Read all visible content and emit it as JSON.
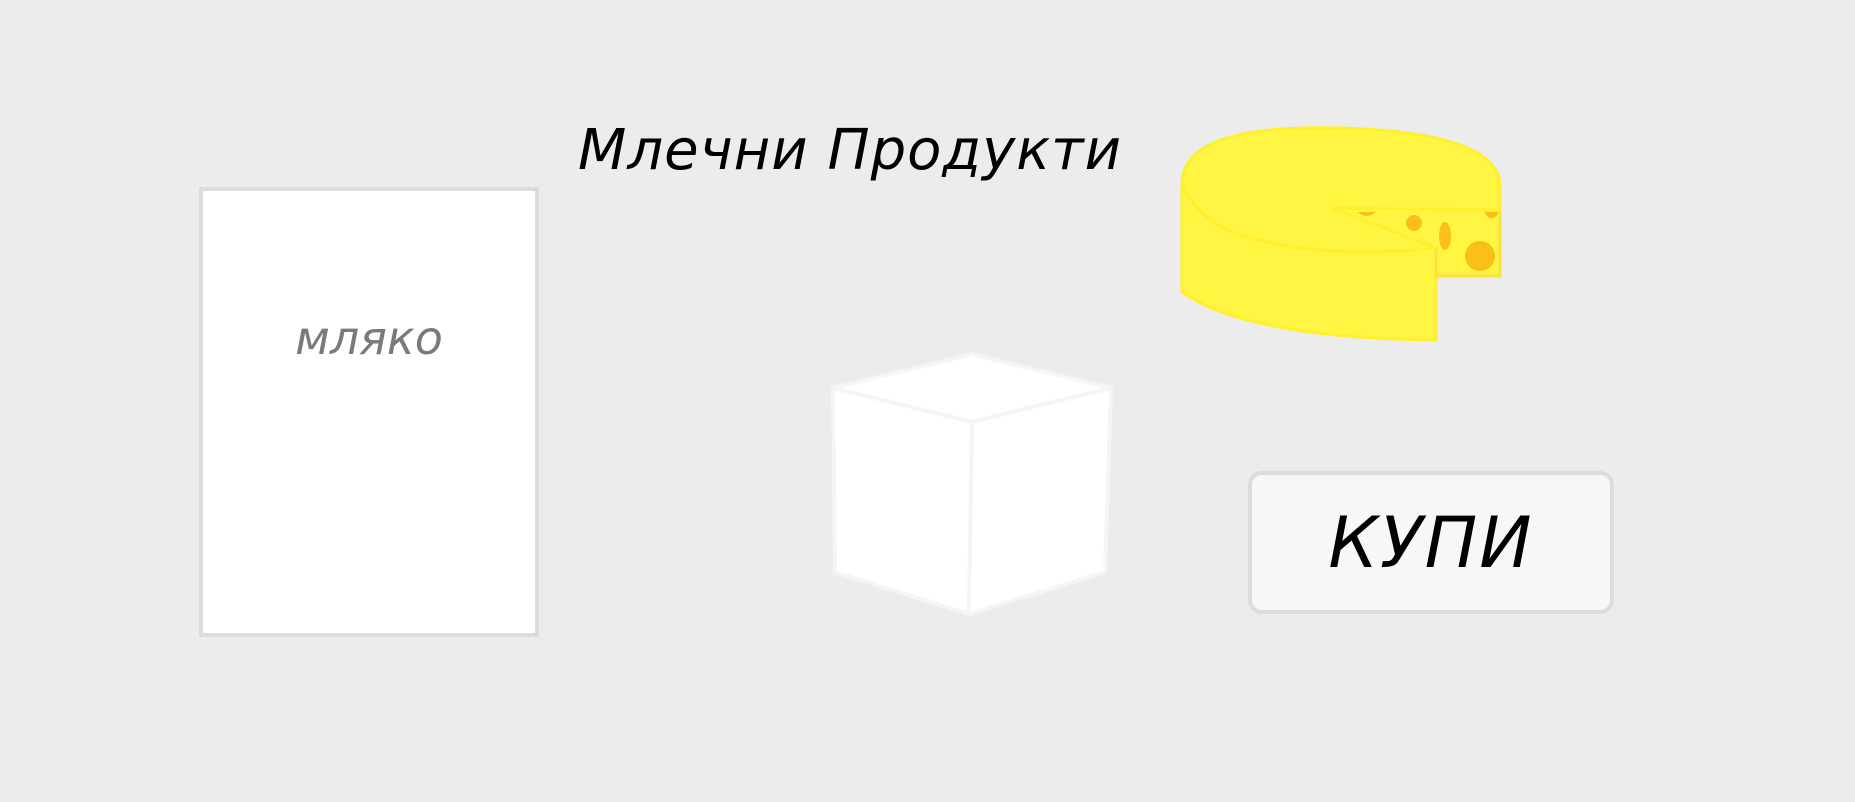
{
  "page": {
    "title": "Млечни Продукти"
  },
  "products": {
    "milk_label": "мляко"
  },
  "actions": {
    "buy_label": "КУПИ"
  },
  "colors": {
    "background": "#ececec",
    "cheese_yellow": "#fff542",
    "cheese_holes": "#fbbf1a",
    "card_border": "#dcdcdc",
    "milk_text": "#7a7a7a"
  },
  "icons": {
    "cube": "cube-icon",
    "cheese": "cheese-icon"
  }
}
